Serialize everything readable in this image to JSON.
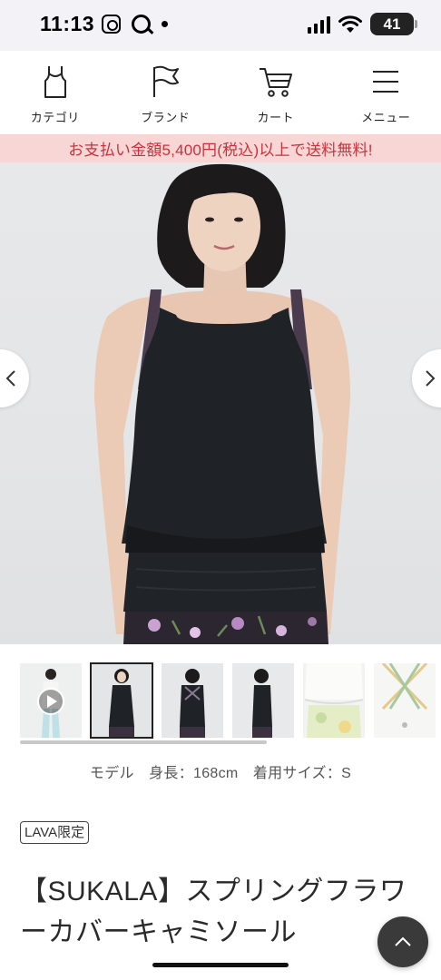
{
  "status_bar": {
    "time": "11:13",
    "battery": "41"
  },
  "nav": {
    "items": [
      {
        "label": "カテゴリ",
        "icon": "tank-top-icon"
      },
      {
        "label": "ブランド",
        "icon": "flag-icon"
      },
      {
        "label": "カート",
        "icon": "cart-icon"
      },
      {
        "label": "メニュー",
        "icon": "hamburger-menu-icon"
      }
    ]
  },
  "promo": {
    "text": "お支払い金額5,400円(税込)以上で送料無料!",
    "color": "#c8333b",
    "background": "#f9d6d6"
  },
  "gallery": {
    "thumbnails": [
      {
        "icon": "play-icon",
        "selected": false
      },
      {
        "selected": true
      },
      {
        "selected": false
      },
      {
        "selected": false
      },
      {
        "selected": false
      },
      {
        "selected": false
      }
    ]
  },
  "model_info": "モデル　身長：168cm　着用サイズ：S",
  "badge": "LAVA限定",
  "product": {
    "title": "【SUKALA】スプリングフラワーカバーキャミソール"
  },
  "colors": {
    "accent": "#c8333b",
    "dark_button": "#3a3a3a"
  }
}
